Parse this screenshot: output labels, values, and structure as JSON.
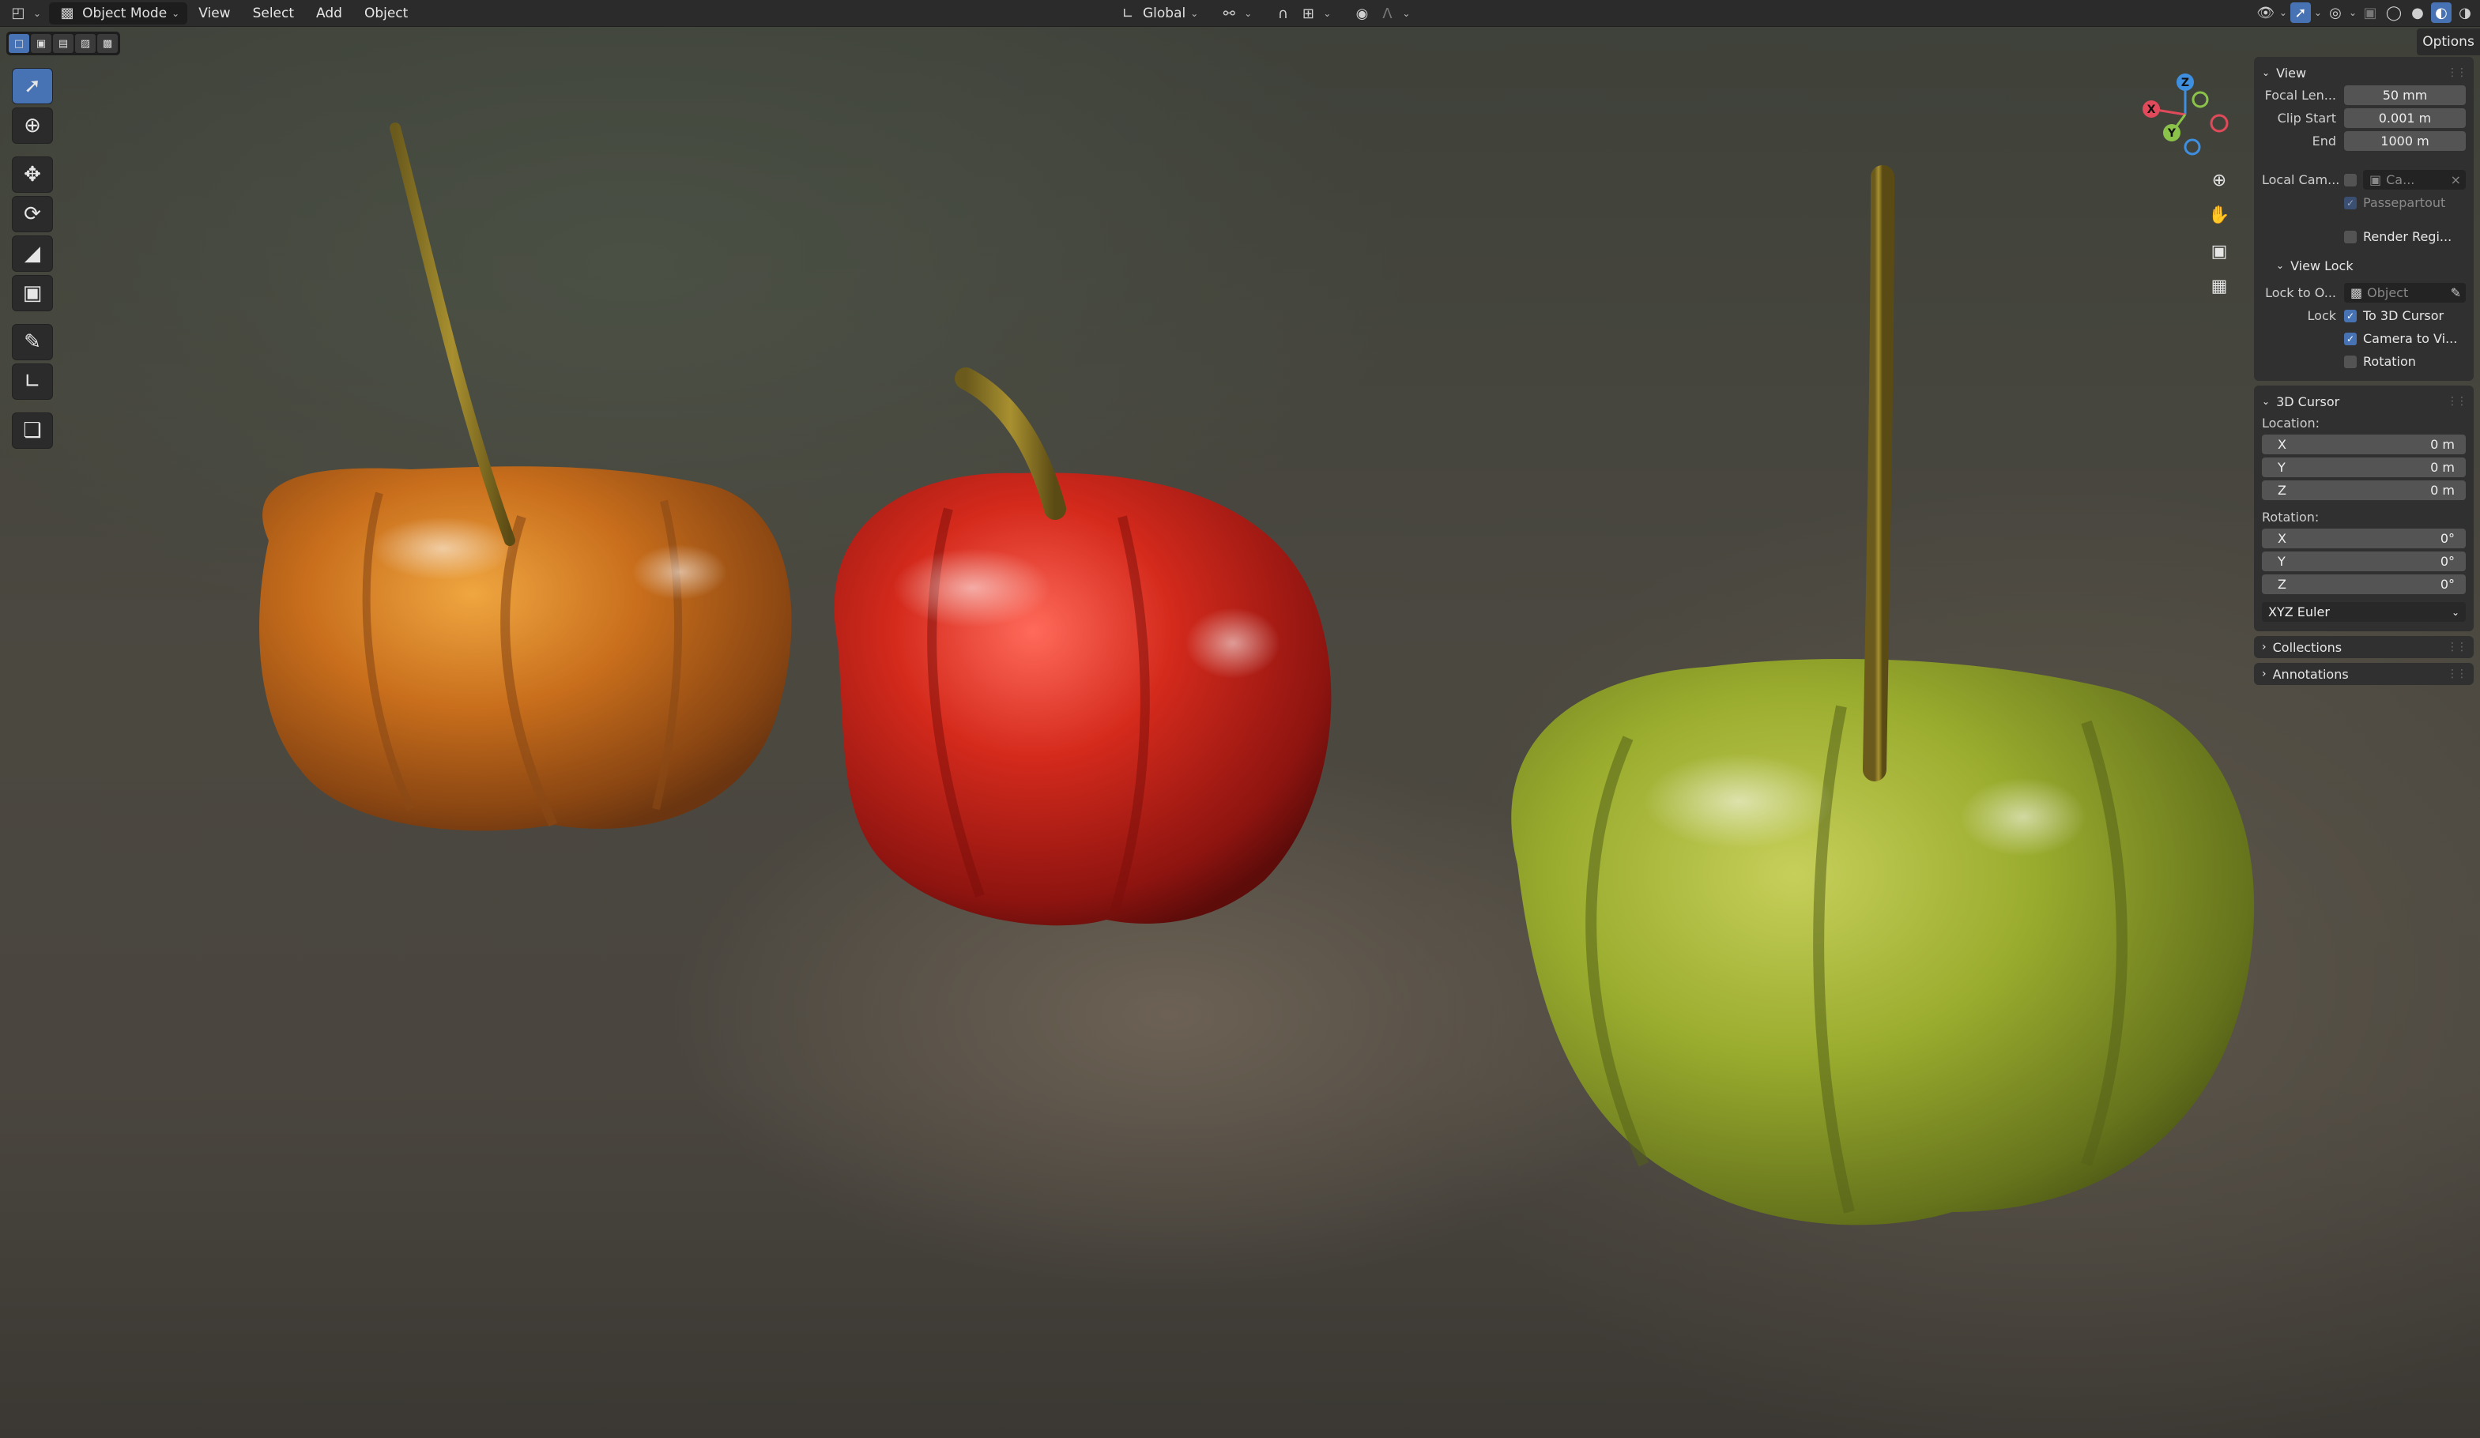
{
  "header": {
    "mode": "Object Mode",
    "menus": [
      "View",
      "Select",
      "Add",
      "Object"
    ],
    "transform_orientation": "Global"
  },
  "options_tab": "Options",
  "panels": {
    "view": {
      "title": "View",
      "focal_length_label": "Focal Len...",
      "focal_length": "50 mm",
      "clip_start_label": "Clip Start",
      "clip_start": "0.001 m",
      "clip_end_label": "End",
      "clip_end": "1000 m",
      "local_camera_label": "Local Cam...",
      "local_camera_value": "Ca...",
      "passepartout_label": "Passepartout",
      "passepartout_checked": true,
      "render_region_label": "Render Regi...",
      "render_region_checked": false
    },
    "view_lock": {
      "title": "View Lock",
      "lock_to_object_label": "Lock to O...",
      "lock_to_object_placeholder": "Object",
      "lock_label": "Lock",
      "to_3d_cursor_label": "To 3D Cursor",
      "to_3d_cursor_checked": true,
      "camera_to_view_label": "Camera to Vi...",
      "camera_to_view_checked": true,
      "rotation_label": "Rotation",
      "rotation_checked": false
    },
    "cursor": {
      "title": "3D Cursor",
      "location_label": "Location:",
      "location": [
        {
          "axis": "X",
          "value": "0 m"
        },
        {
          "axis": "Y",
          "value": "0 m"
        },
        {
          "axis": "Z",
          "value": "0 m"
        }
      ],
      "rotation_label": "Rotation:",
      "rotation": [
        {
          "axis": "X",
          "value": "0°"
        },
        {
          "axis": "Y",
          "value": "0°"
        },
        {
          "axis": "Z",
          "value": "0°"
        }
      ],
      "rotation_mode": "XYZ Euler"
    },
    "collections": {
      "title": "Collections"
    },
    "annotations": {
      "title": "Annotations"
    }
  },
  "gizmo": {
    "x_label": "X",
    "y_label": "Y",
    "z_label": "Z"
  },
  "colors": {
    "accent": "#4772b3",
    "x_axis": "#e04a5a",
    "y_axis": "#8bc34a",
    "z_axis": "#3f8fe0"
  }
}
